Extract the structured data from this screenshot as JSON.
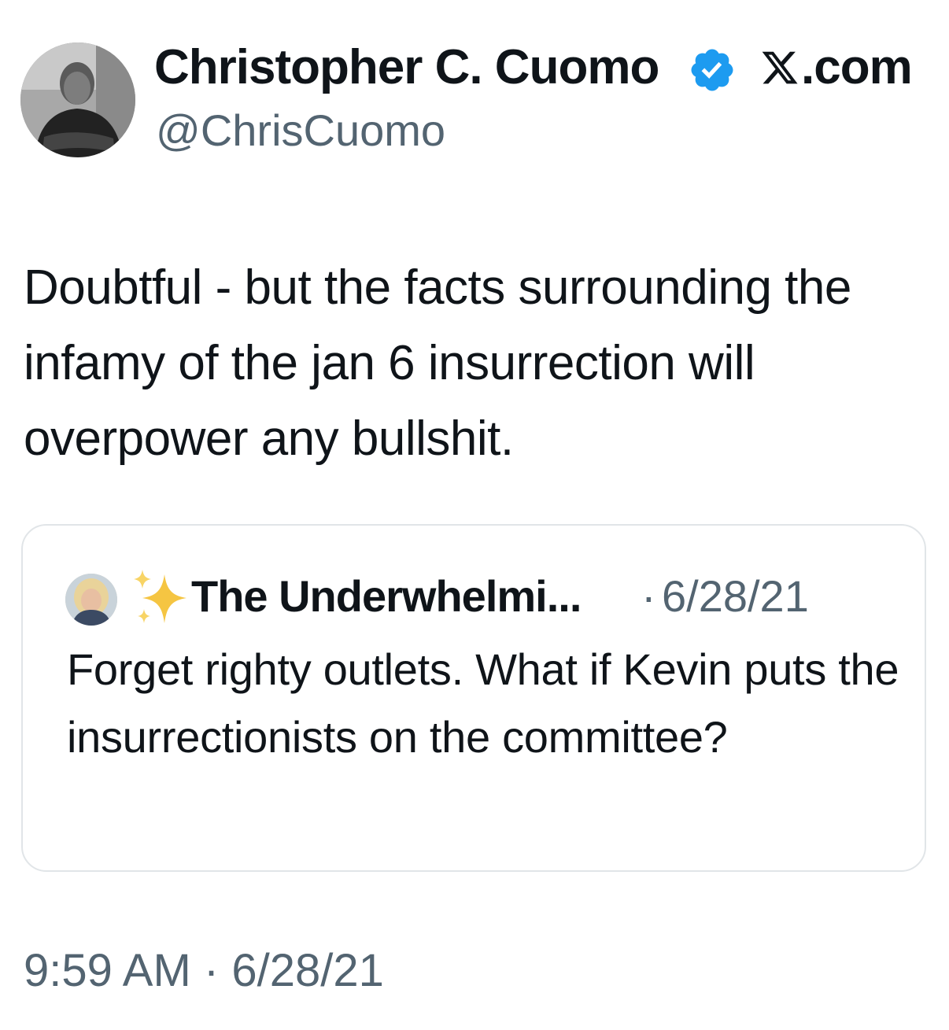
{
  "author": {
    "display_name": "Christopher C. Cuomo",
    "handle": "@ChrisCuomo",
    "verified_color": "#1d9bf0"
  },
  "site": {
    "logo_icon": "x-logo-icon",
    "label": ".com"
  },
  "tweet": {
    "text": "Doubtful - but the facts surrounding the infamy of the jan 6 insurrection will overpower any bullshit."
  },
  "quoted_tweet": {
    "emoji": "sparkles-icon",
    "display_name": "The Underwhelmi...",
    "separator": "·",
    "date": "6/28/21",
    "text": "Forget righty outlets. What if Kevin puts the insurrectionists on the committee?"
  },
  "footer": {
    "timestamp": "9:59 AM · 6/28/21"
  },
  "colors": {
    "text": "#0f1419",
    "secondary": "#536471",
    "border": "#e1e5e8"
  }
}
